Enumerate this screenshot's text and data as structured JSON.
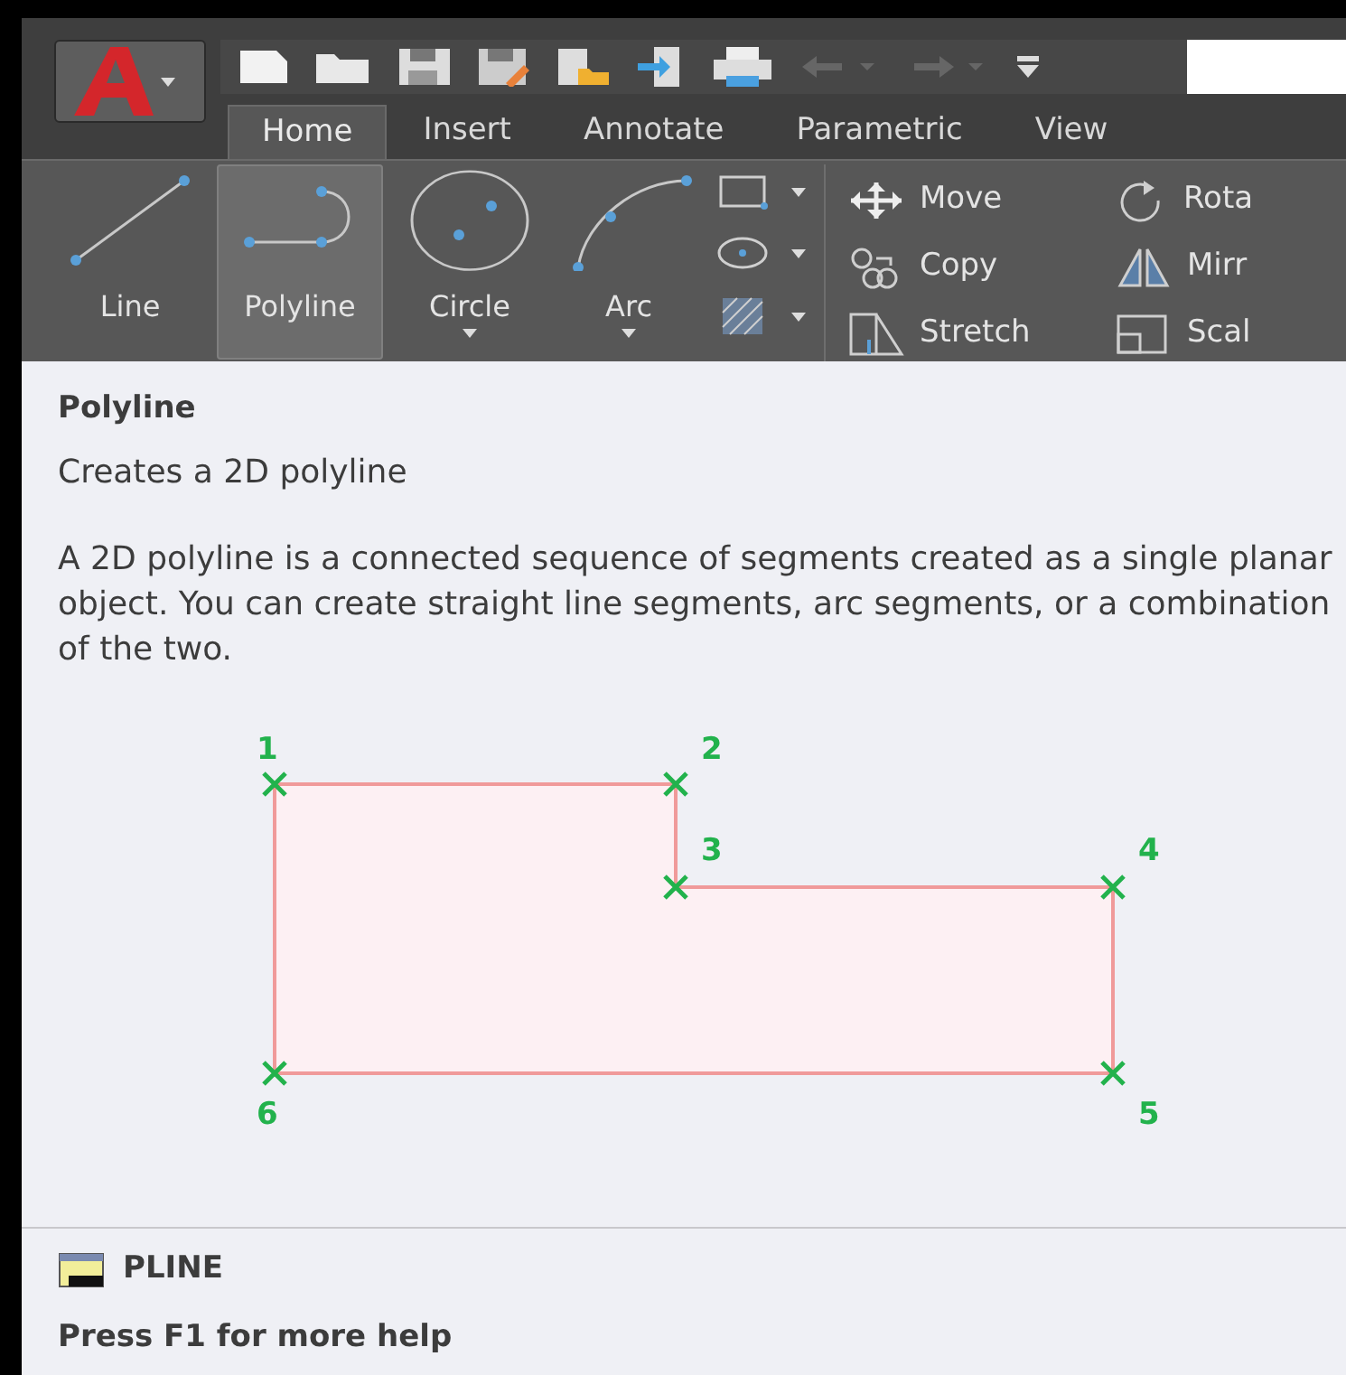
{
  "app_button": {
    "dropdown": true
  },
  "tabs": [
    {
      "label": "Home",
      "selected": true
    },
    {
      "label": "Insert",
      "selected": false
    },
    {
      "label": "Annotate",
      "selected": false
    },
    {
      "label": "Parametric",
      "selected": false
    },
    {
      "label": "View",
      "selected": false
    }
  ],
  "draw_tools": [
    {
      "label": "Line",
      "kind": "line",
      "selected": false,
      "dropdown": false
    },
    {
      "label": "Polyline",
      "kind": "polyline",
      "selected": true,
      "dropdown": false
    },
    {
      "label": "Circle",
      "kind": "circle",
      "selected": false,
      "dropdown": true
    },
    {
      "label": "Arc",
      "kind": "arc",
      "selected": false,
      "dropdown": true
    }
  ],
  "modify_tools": [
    {
      "label": "Move",
      "kind": "move"
    },
    {
      "label": "Rota",
      "kind": "rotate"
    },
    {
      "label": "Copy",
      "kind": "copy"
    },
    {
      "label": "Mirr",
      "kind": "mirror"
    },
    {
      "label": "Stretch",
      "kind": "stretch"
    },
    {
      "label": "Scal",
      "kind": "scale"
    }
  ],
  "tooltip": {
    "title": "Polyline",
    "summary": "Creates a 2D polyline",
    "description": "A 2D polyline is a connected sequence of segments created as a single planar object. You can create straight line segments, arc segments, or a combination of the two.",
    "point_labels": [
      "1",
      "2",
      "3",
      "4",
      "6",
      "5"
    ],
    "command": "PLINE",
    "help": "Press F1 for more help"
  }
}
